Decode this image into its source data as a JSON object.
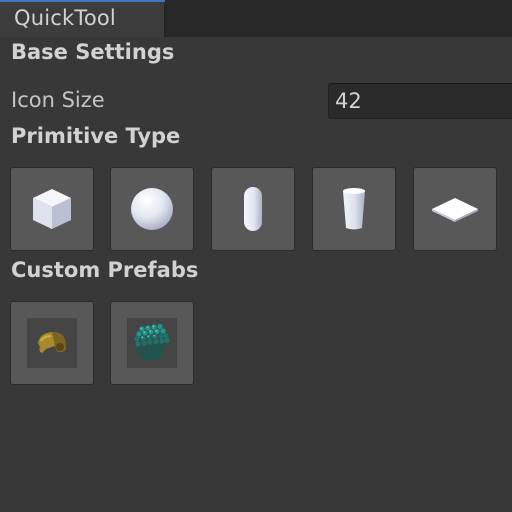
{
  "window": {
    "tab_title": "QuickTool",
    "accent_color": "#3a79bb"
  },
  "base_settings": {
    "heading": "Base Settings",
    "icon_size": {
      "label": "Icon Size",
      "value": "42"
    }
  },
  "primitive_type": {
    "heading": "Primitive Type",
    "items": [
      {
        "icon": "cube-icon"
      },
      {
        "icon": "sphere-icon"
      },
      {
        "icon": "capsule-icon"
      },
      {
        "icon": "cylinder-icon"
      },
      {
        "icon": "plane-icon"
      }
    ]
  },
  "custom_prefabs": {
    "heading": "Custom Prefabs",
    "items": [
      {
        "icon": "helmet-prefab-icon"
      },
      {
        "icon": "sphere-grid-prefab-icon"
      }
    ]
  }
}
